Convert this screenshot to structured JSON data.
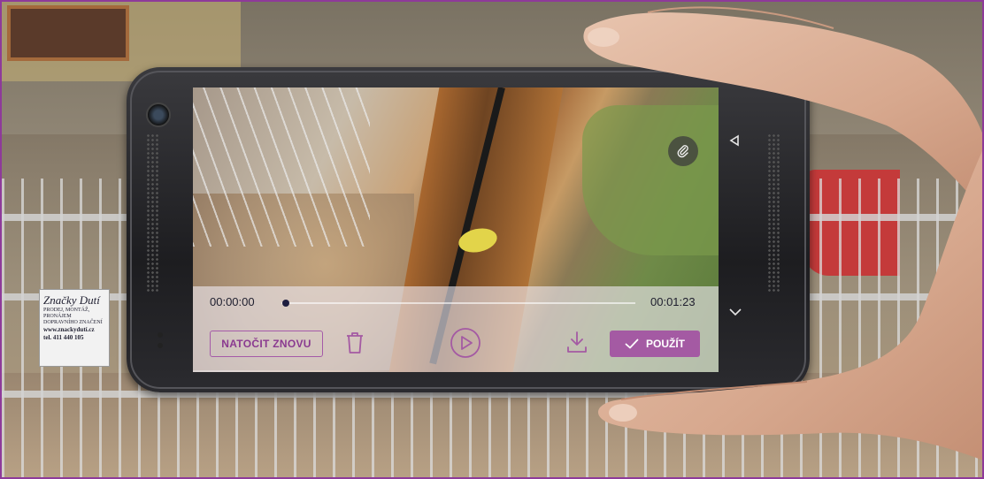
{
  "player": {
    "time_start": "00:00:00",
    "time_end": "00:01:23",
    "progress": 0.0
  },
  "controls": {
    "redo_label": "NATOČIT ZNOVU",
    "use_label": "POUŽÍT"
  },
  "background_sign": {
    "brand": "Značky Dutí",
    "line1": "PRODEJ, MONTÁŽ, PRONÁJEM",
    "line2": "DOPRAVNÍHO ZNAČENÍ",
    "web": "www.znackydutí.cz",
    "phone": "tel. 411 440 105"
  },
  "icons": {
    "attach": "paperclip-icon",
    "delete": "trash-icon",
    "play": "play-icon",
    "download": "download-icon",
    "confirm": "check-icon",
    "nav_back": "triangle-left-icon",
    "nav_down": "chevron-down-icon"
  },
  "colors": {
    "accent": "#a45aa3",
    "accent_text": "#8a3a90",
    "frame_border": "#8e3a9a"
  }
}
